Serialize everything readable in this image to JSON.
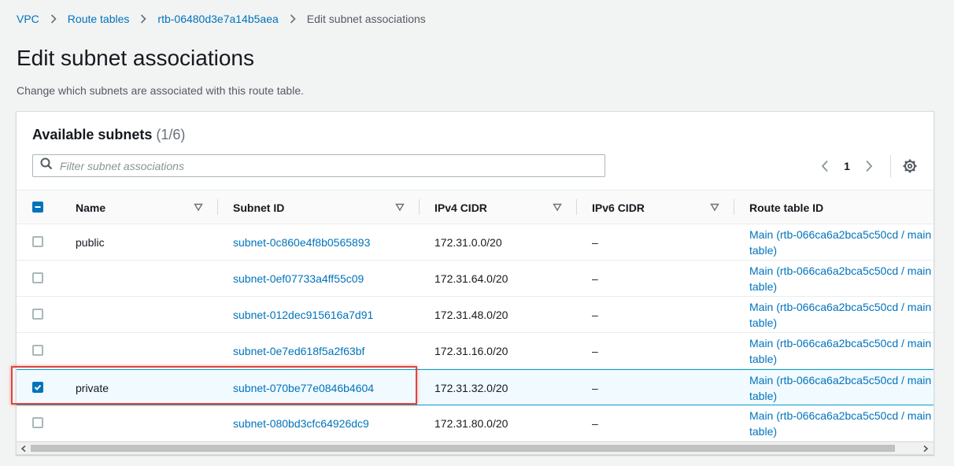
{
  "breadcrumb": {
    "items": [
      "VPC",
      "Route tables",
      "rtb-06480d3e7a14b5aea"
    ],
    "current": "Edit subnet associations"
  },
  "page": {
    "title": "Edit subnet associations",
    "description": "Change which subnets are associated with this route table."
  },
  "panel": {
    "title": "Available subnets",
    "count": "(1/6)",
    "filter_placeholder": "Filter subnet associations",
    "page_number": "1"
  },
  "columns": {
    "name": "Name",
    "subnet_id": "Subnet ID",
    "ipv4": "IPv4 CIDR",
    "ipv6": "IPv6 CIDR",
    "route_table": "Route table ID"
  },
  "rows": [
    {
      "name": "public",
      "subnet_id": "subnet-0c860e4f8b0565893",
      "ipv4": "172.31.0.0/20",
      "ipv6": "–",
      "route_table": "Main (rtb-066ca6a2bca5c50cd / main table)",
      "checked": false
    },
    {
      "name": "",
      "subnet_id": "subnet-0ef07733a4ff55c09",
      "ipv4": "172.31.64.0/20",
      "ipv6": "–",
      "route_table": "Main (rtb-066ca6a2bca5c50cd / main table)",
      "checked": false
    },
    {
      "name": "",
      "subnet_id": "subnet-012dec915616a7d91",
      "ipv4": "172.31.48.0/20",
      "ipv6": "–",
      "route_table": "Main (rtb-066ca6a2bca5c50cd / main table)",
      "checked": false
    },
    {
      "name": "",
      "subnet_id": "subnet-0e7ed618f5a2f63bf",
      "ipv4": "172.31.16.0/20",
      "ipv6": "–",
      "route_table": "Main (rtb-066ca6a2bca5c50cd / main table)",
      "checked": false
    },
    {
      "name": "private",
      "subnet_id": "subnet-070be77e0846b4604",
      "ipv4": "172.31.32.0/20",
      "ipv6": "–",
      "route_table": "Main (rtb-066ca6a2bca5c50cd / main table)",
      "checked": true
    },
    {
      "name": "",
      "subnet_id": "subnet-080bd3cfc64926dc9",
      "ipv4": "172.31.80.0/20",
      "ipv6": "–",
      "route_table": "Main (rtb-066ca6a2bca5c50cd / main table)",
      "checked": false
    }
  ],
  "colors": {
    "link": "#0073bb",
    "accent": "#0073bb",
    "highlight": "#e0443c"
  }
}
